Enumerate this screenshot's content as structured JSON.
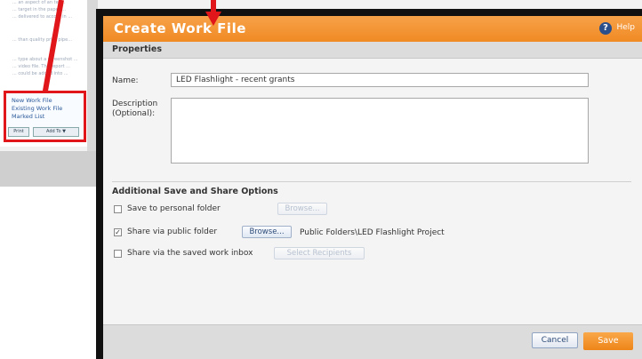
{
  "background": {
    "panel_lines": [
      "... an aspect of an tec...",
      "... target in the paper ...",
      "... delivered to accord in ...",
      "... than quality prior pipe...",
      "... type about a screenshot ...",
      "... video file. The report ...",
      "... could be added into ..."
    ],
    "callout_links": [
      "New Work File",
      "Existing Work File",
      "Marked List"
    ],
    "callout_buttons": [
      "Print",
      "Add To ▼"
    ]
  },
  "dialog": {
    "title": "Create Work File",
    "help_label": "Help",
    "section_title": "Properties",
    "name_label": "Name:",
    "name_value": "LED Flashlight - recent grants",
    "description_label": "Description (Optional):",
    "description_value": "",
    "options_header": "Additional Save and Share Options",
    "options": [
      {
        "label": "Save to personal folder",
        "checked": false,
        "button": "Browse...",
        "button_enabled": false
      },
      {
        "label": "Share via public folder",
        "checked": true,
        "button": "Browse...",
        "button_enabled": true,
        "path": "Public Folders\\LED Flashlight Project"
      },
      {
        "label": "Share via the saved work inbox",
        "checked": false,
        "button": "Select Recipients",
        "button_enabled": false
      }
    ],
    "cancel_label": "Cancel",
    "save_label": "Save"
  },
  "colors": {
    "accent": "#f08a23",
    "callout": "#e0161a",
    "link": "#2c5a9a"
  }
}
